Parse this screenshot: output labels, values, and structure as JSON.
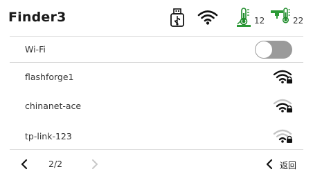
{
  "header": {
    "title": "Finder3",
    "extruder_temp": "12",
    "bed_temp": "22",
    "icons": [
      "usb-drive-icon",
      "wifi-icon",
      "extruder-temp-icon",
      "bed-temp-icon"
    ],
    "colors": {
      "temp_accent": "#1e8c2a",
      "temp_bar": "#2b9a36"
    }
  },
  "wifi": {
    "label": "Wi-Fi",
    "toggle_on": false
  },
  "networks": [
    {
      "name": "flashforge1",
      "signal": "strong",
      "locked": true
    },
    {
      "name": "chinanet-ace",
      "signal": "medium",
      "locked": true
    },
    {
      "name": "tp-link-123",
      "signal": "weak",
      "locked": true
    }
  ],
  "footer": {
    "page": "2/2",
    "back_label": "返回"
  }
}
